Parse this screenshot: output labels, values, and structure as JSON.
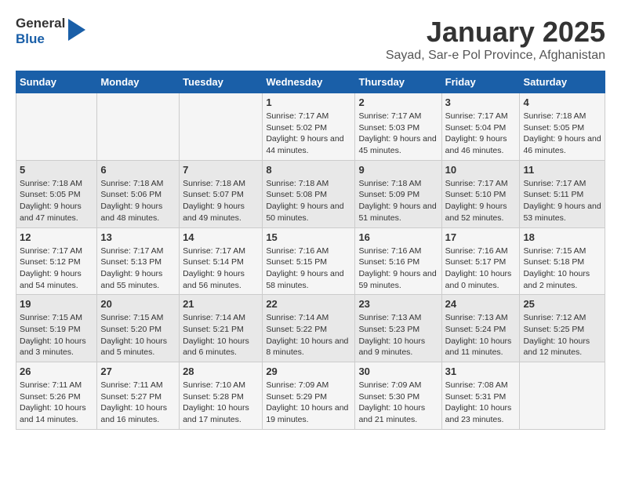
{
  "logo": {
    "general": "General",
    "blue": "Blue"
  },
  "title": "January 2025",
  "location": "Sayad, Sar-e Pol Province, Afghanistan",
  "headers": [
    "Sunday",
    "Monday",
    "Tuesday",
    "Wednesday",
    "Thursday",
    "Friday",
    "Saturday"
  ],
  "weeks": [
    [
      {
        "day": "",
        "sunrise": "",
        "sunset": "",
        "daylight": ""
      },
      {
        "day": "",
        "sunrise": "",
        "sunset": "",
        "daylight": ""
      },
      {
        "day": "",
        "sunrise": "",
        "sunset": "",
        "daylight": ""
      },
      {
        "day": "1",
        "sunrise": "Sunrise: 7:17 AM",
        "sunset": "Sunset: 5:02 PM",
        "daylight": "Daylight: 9 hours and 44 minutes."
      },
      {
        "day": "2",
        "sunrise": "Sunrise: 7:17 AM",
        "sunset": "Sunset: 5:03 PM",
        "daylight": "Daylight: 9 hours and 45 minutes."
      },
      {
        "day": "3",
        "sunrise": "Sunrise: 7:17 AM",
        "sunset": "Sunset: 5:04 PM",
        "daylight": "Daylight: 9 hours and 46 minutes."
      },
      {
        "day": "4",
        "sunrise": "Sunrise: 7:18 AM",
        "sunset": "Sunset: 5:05 PM",
        "daylight": "Daylight: 9 hours and 46 minutes."
      }
    ],
    [
      {
        "day": "5",
        "sunrise": "Sunrise: 7:18 AM",
        "sunset": "Sunset: 5:05 PM",
        "daylight": "Daylight: 9 hours and 47 minutes."
      },
      {
        "day": "6",
        "sunrise": "Sunrise: 7:18 AM",
        "sunset": "Sunset: 5:06 PM",
        "daylight": "Daylight: 9 hours and 48 minutes."
      },
      {
        "day": "7",
        "sunrise": "Sunrise: 7:18 AM",
        "sunset": "Sunset: 5:07 PM",
        "daylight": "Daylight: 9 hours and 49 minutes."
      },
      {
        "day": "8",
        "sunrise": "Sunrise: 7:18 AM",
        "sunset": "Sunset: 5:08 PM",
        "daylight": "Daylight: 9 hours and 50 minutes."
      },
      {
        "day": "9",
        "sunrise": "Sunrise: 7:18 AM",
        "sunset": "Sunset: 5:09 PM",
        "daylight": "Daylight: 9 hours and 51 minutes."
      },
      {
        "day": "10",
        "sunrise": "Sunrise: 7:17 AM",
        "sunset": "Sunset: 5:10 PM",
        "daylight": "Daylight: 9 hours and 52 minutes."
      },
      {
        "day": "11",
        "sunrise": "Sunrise: 7:17 AM",
        "sunset": "Sunset: 5:11 PM",
        "daylight": "Daylight: 9 hours and 53 minutes."
      }
    ],
    [
      {
        "day": "12",
        "sunrise": "Sunrise: 7:17 AM",
        "sunset": "Sunset: 5:12 PM",
        "daylight": "Daylight: 9 hours and 54 minutes."
      },
      {
        "day": "13",
        "sunrise": "Sunrise: 7:17 AM",
        "sunset": "Sunset: 5:13 PM",
        "daylight": "Daylight: 9 hours and 55 minutes."
      },
      {
        "day": "14",
        "sunrise": "Sunrise: 7:17 AM",
        "sunset": "Sunset: 5:14 PM",
        "daylight": "Daylight: 9 hours and 56 minutes."
      },
      {
        "day": "15",
        "sunrise": "Sunrise: 7:16 AM",
        "sunset": "Sunset: 5:15 PM",
        "daylight": "Daylight: 9 hours and 58 minutes."
      },
      {
        "day": "16",
        "sunrise": "Sunrise: 7:16 AM",
        "sunset": "Sunset: 5:16 PM",
        "daylight": "Daylight: 9 hours and 59 minutes."
      },
      {
        "day": "17",
        "sunrise": "Sunrise: 7:16 AM",
        "sunset": "Sunset: 5:17 PM",
        "daylight": "Daylight: 10 hours and 0 minutes."
      },
      {
        "day": "18",
        "sunrise": "Sunrise: 7:15 AM",
        "sunset": "Sunset: 5:18 PM",
        "daylight": "Daylight: 10 hours and 2 minutes."
      }
    ],
    [
      {
        "day": "19",
        "sunrise": "Sunrise: 7:15 AM",
        "sunset": "Sunset: 5:19 PM",
        "daylight": "Daylight: 10 hours and 3 minutes."
      },
      {
        "day": "20",
        "sunrise": "Sunrise: 7:15 AM",
        "sunset": "Sunset: 5:20 PM",
        "daylight": "Daylight: 10 hours and 5 minutes."
      },
      {
        "day": "21",
        "sunrise": "Sunrise: 7:14 AM",
        "sunset": "Sunset: 5:21 PM",
        "daylight": "Daylight: 10 hours and 6 minutes."
      },
      {
        "day": "22",
        "sunrise": "Sunrise: 7:14 AM",
        "sunset": "Sunset: 5:22 PM",
        "daylight": "Daylight: 10 hours and 8 minutes."
      },
      {
        "day": "23",
        "sunrise": "Sunrise: 7:13 AM",
        "sunset": "Sunset: 5:23 PM",
        "daylight": "Daylight: 10 hours and 9 minutes."
      },
      {
        "day": "24",
        "sunrise": "Sunrise: 7:13 AM",
        "sunset": "Sunset: 5:24 PM",
        "daylight": "Daylight: 10 hours and 11 minutes."
      },
      {
        "day": "25",
        "sunrise": "Sunrise: 7:12 AM",
        "sunset": "Sunset: 5:25 PM",
        "daylight": "Daylight: 10 hours and 12 minutes."
      }
    ],
    [
      {
        "day": "26",
        "sunrise": "Sunrise: 7:11 AM",
        "sunset": "Sunset: 5:26 PM",
        "daylight": "Daylight: 10 hours and 14 minutes."
      },
      {
        "day": "27",
        "sunrise": "Sunrise: 7:11 AM",
        "sunset": "Sunset: 5:27 PM",
        "daylight": "Daylight: 10 hours and 16 minutes."
      },
      {
        "day": "28",
        "sunrise": "Sunrise: 7:10 AM",
        "sunset": "Sunset: 5:28 PM",
        "daylight": "Daylight: 10 hours and 17 minutes."
      },
      {
        "day": "29",
        "sunrise": "Sunrise: 7:09 AM",
        "sunset": "Sunset: 5:29 PM",
        "daylight": "Daylight: 10 hours and 19 minutes."
      },
      {
        "day": "30",
        "sunrise": "Sunrise: 7:09 AM",
        "sunset": "Sunset: 5:30 PM",
        "daylight": "Daylight: 10 hours and 21 minutes."
      },
      {
        "day": "31",
        "sunrise": "Sunrise: 7:08 AM",
        "sunset": "Sunset: 5:31 PM",
        "daylight": "Daylight: 10 hours and 23 minutes."
      },
      {
        "day": "",
        "sunrise": "",
        "sunset": "",
        "daylight": ""
      }
    ]
  ]
}
